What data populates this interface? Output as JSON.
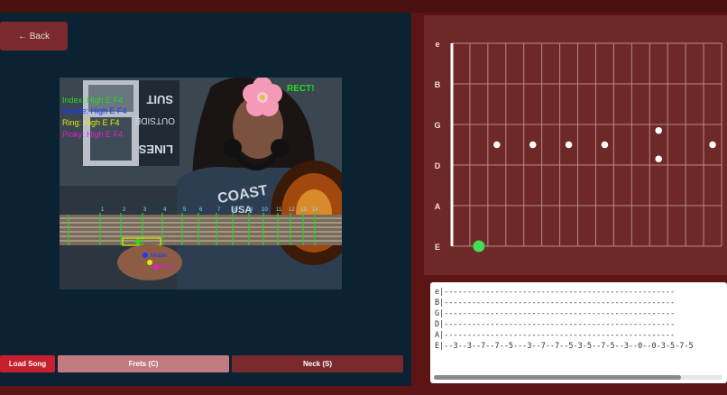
{
  "nav": {
    "back_label": "← Back"
  },
  "camera": {
    "overlay_lines": [
      {
        "text": "Index: High E F4",
        "color": "#22dd22"
      },
      {
        "text": "Middle: High E F4",
        "color": "#1a3cff"
      },
      {
        "text": "Ring: High E F4",
        "color": "#e8e800"
      },
      {
        "text": "Pinky: High E F4",
        "color": "#e020d0"
      }
    ],
    "status_text": "RECT!",
    "fret_numbers": [
      "1",
      "2",
      "3",
      "4",
      "5",
      "6",
      "7",
      "8",
      "9",
      "10",
      "11",
      "12",
      "13",
      "14"
    ],
    "finger_labels": [
      "Middle",
      "Pinky"
    ],
    "shirt_text": [
      "COAST",
      "USA"
    ]
  },
  "controls": {
    "load_song": "Load Song",
    "frets": "Frets (C)",
    "neck": "Neck (S)"
  },
  "fretboard": {
    "strings": [
      "e",
      "B",
      "G",
      "D",
      "A",
      "E"
    ],
    "fret_count": 15,
    "active_note": {
      "string": "E",
      "fret": 2
    },
    "inlay_frets": [
      3,
      5,
      7,
      9,
      12,
      15
    ],
    "double_inlay_fret": 12
  },
  "tab": {
    "lines": [
      "e|--------------------------------------------------",
      "B|--------------------------------------------------",
      "G|--------------------------------------------------",
      "D|--------------------------------------------------",
      "A|--------------------------------------------------",
      "E|--3--3--7--7--5---3--7--7--5-3-5--7-5--3--0--0-3-5-7-5"
    ]
  },
  "colors": {
    "page_bg": "#5c1414",
    "left_bg": "#0b2233",
    "fretboard_bg": "#6e2828",
    "load_song": "#c81f2e",
    "frets_btn": "#c07a80",
    "neck_btn": "#7a2a2e",
    "active_note": "#44dd55"
  }
}
